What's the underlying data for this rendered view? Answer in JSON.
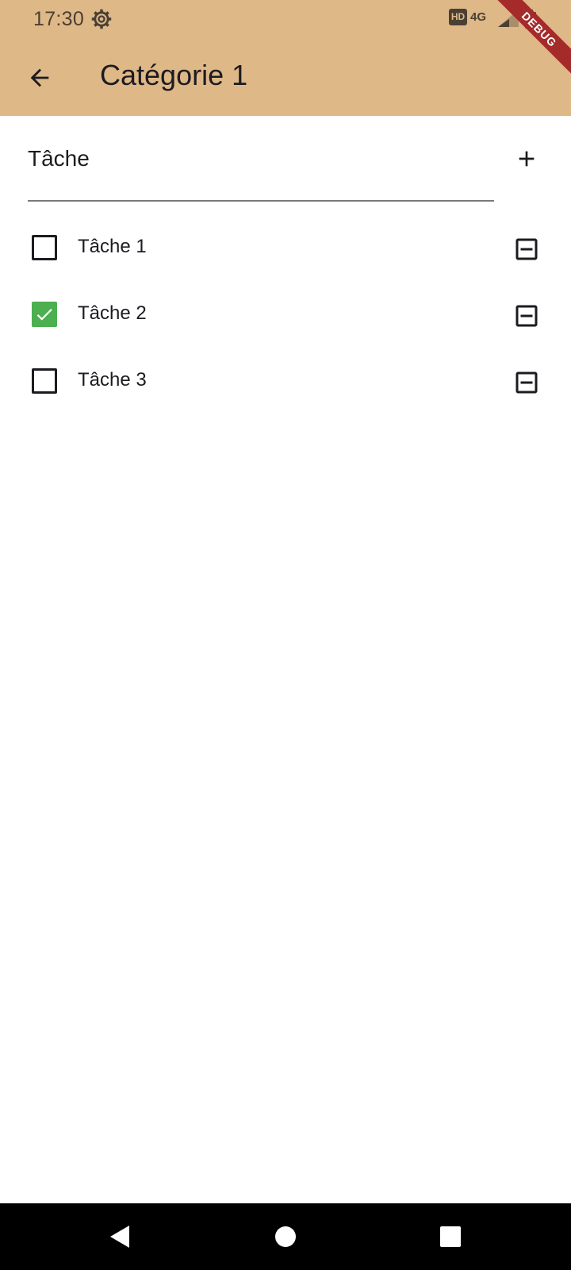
{
  "status_bar": {
    "time": "17:30",
    "hd_badge": "HD",
    "network": "4G"
  },
  "debug_banner": "DEBUG",
  "app_bar": {
    "title": "Catégorie 1",
    "back_icon": "arrow-back-icon"
  },
  "input": {
    "placeholder": "Tâche",
    "value": "",
    "add_icon": "plus-icon"
  },
  "tasks": [
    {
      "label": "Tâche 1",
      "checked": false
    },
    {
      "label": "Tâche 2",
      "checked": true
    },
    {
      "label": "Tâche 3",
      "checked": false
    }
  ],
  "colors": {
    "app_bar_bg": "#deb887",
    "checkbox_checked": "#4caf50",
    "debug_ribbon": "#a52a2a"
  },
  "nav_bar": {
    "back_icon": "triangle-back-icon",
    "home_icon": "circle-home-icon",
    "recents_icon": "square-recents-icon"
  }
}
